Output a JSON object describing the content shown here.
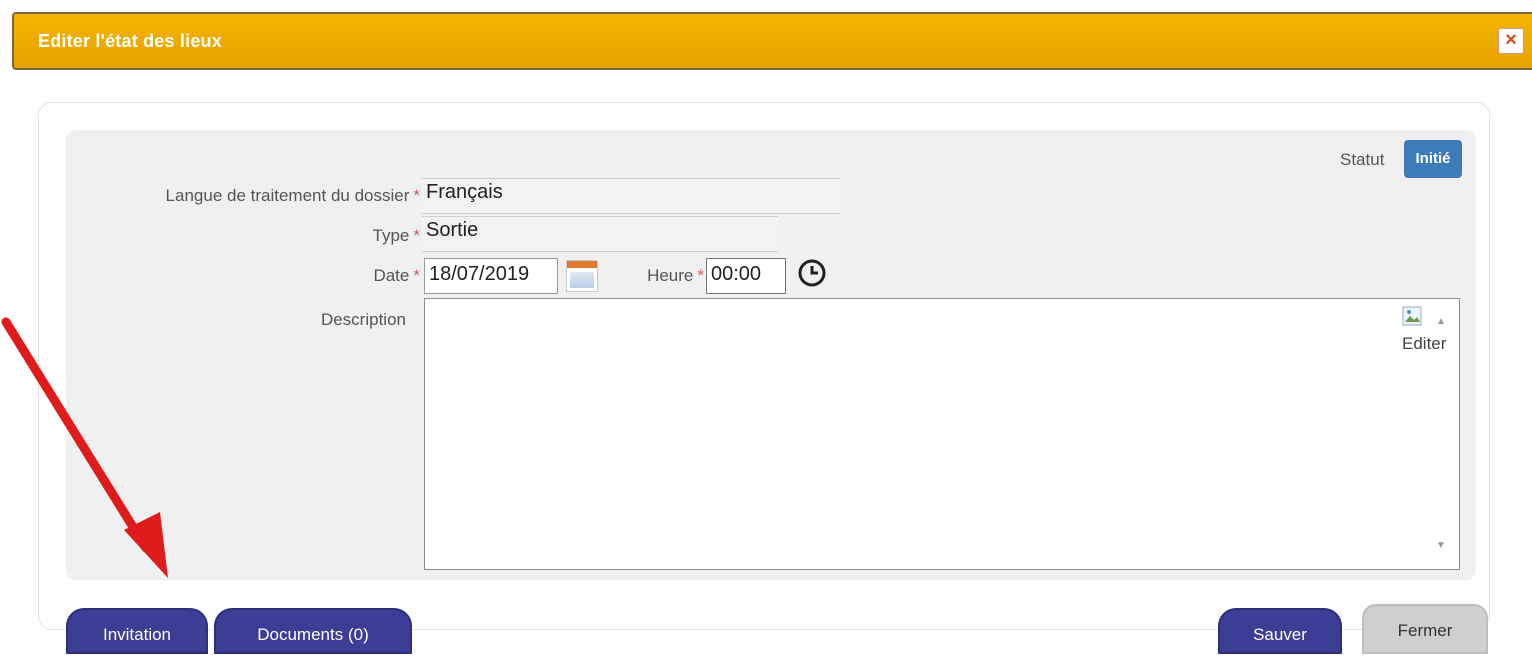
{
  "dialog": {
    "title": "Editer l'état des lieux",
    "close_icon": "close-icon"
  },
  "form": {
    "status": {
      "label": "Statut",
      "value": "Initié",
      "color": "#3d7cb8"
    },
    "langue": {
      "label": "Langue de traitement du dossier",
      "required": "*",
      "value": "Français"
    },
    "type": {
      "label": "Type",
      "required": "*",
      "value": "Sortie"
    },
    "date": {
      "label": "Date",
      "required": "*",
      "value": "18/07/2019",
      "icon": "calendar-icon"
    },
    "heure": {
      "label": "Heure",
      "required": "*",
      "value": "00:00",
      "icon": "clock-icon"
    },
    "description": {
      "label": "Description",
      "value": "",
      "edit_label": "Editer"
    }
  },
  "buttons": {
    "invitation": "Invitation",
    "documents": "Documents (0)",
    "sauver": "Sauver",
    "fermer": "Fermer"
  },
  "colors": {
    "titlebar": "#f4b400",
    "primary_button": "#3c3d94",
    "annotation_arrow": "#e01b1b"
  }
}
